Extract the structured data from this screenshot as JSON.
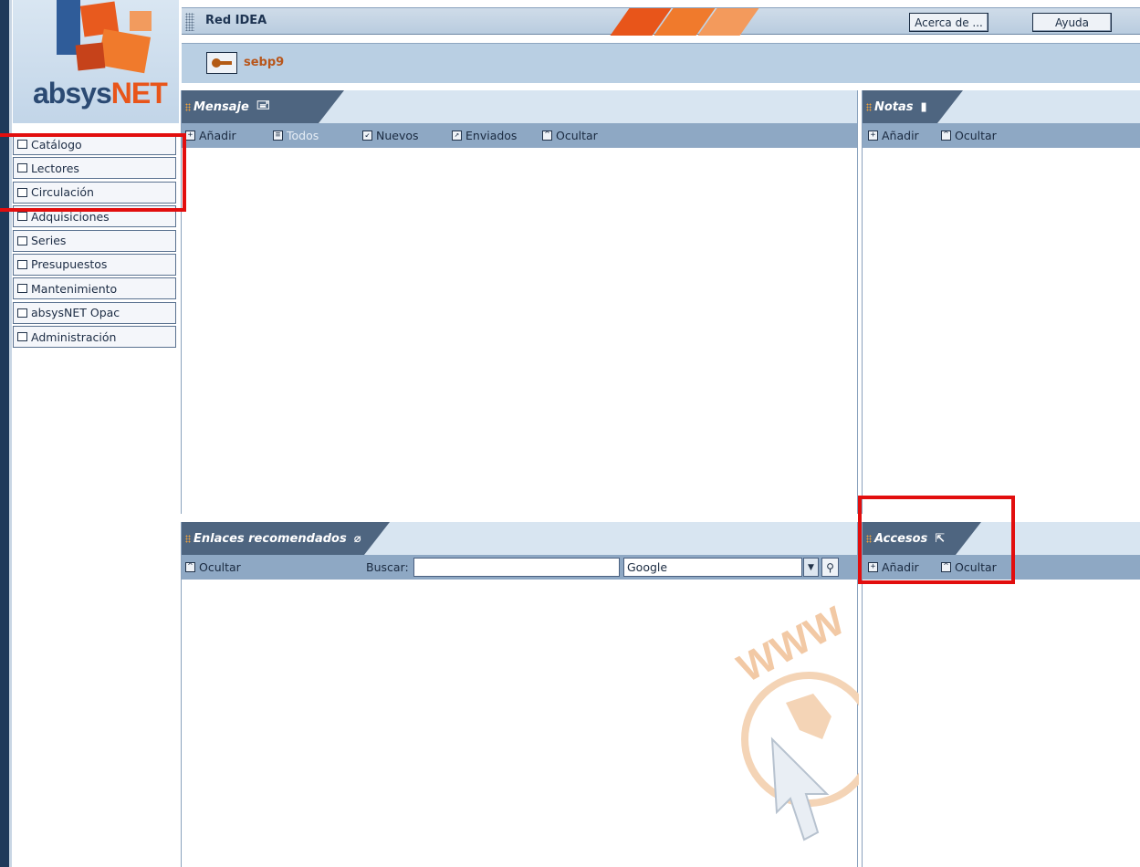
{
  "app": {
    "logo_text_a": "absys",
    "logo_text_b": "NET",
    "title": "Red IDEA",
    "about_button": "Acerca de ...",
    "help_button": "Ayuda",
    "username": "sebp9"
  },
  "sidebar": {
    "items": [
      {
        "label": "Catálogo"
      },
      {
        "label": "Lectores"
      },
      {
        "label": "Circulación"
      },
      {
        "label": "Adquisiciones"
      },
      {
        "label": "Series"
      },
      {
        "label": "Presupuestos"
      },
      {
        "label": "Mantenimiento"
      },
      {
        "label": "absysNET Opac"
      },
      {
        "label": "Administración"
      }
    ]
  },
  "mensaje": {
    "title": "Mensaje",
    "toolbar": {
      "add": "Añadir",
      "all": "Todos",
      "new": "Nuevos",
      "sent": "Enviados",
      "hide": "Ocultar"
    }
  },
  "notas": {
    "title": "Notas",
    "toolbar": {
      "add": "Añadir",
      "hide": "Ocultar"
    }
  },
  "enlaces": {
    "title": "Enlaces recomendados",
    "toolbar": {
      "hide": "Ocultar",
      "search_label": "Buscar:",
      "search_value": "",
      "engine": "Google"
    }
  },
  "accesos": {
    "title": "Accesos",
    "toolbar": {
      "add": "Añadir",
      "hide": "Ocultar"
    }
  },
  "watermark": {
    "text": "WWW"
  },
  "colors": {
    "annotation": "#e20e0e",
    "panel_tab": "#4e6580",
    "toolbar": "#8ea8c4",
    "accent_orange": "#e8551a"
  }
}
